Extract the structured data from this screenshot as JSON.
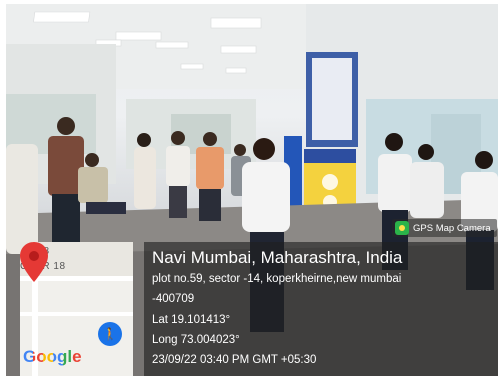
{
  "badge": {
    "label": "GPS Map Camera",
    "icon": "gps-camera-icon"
  },
  "map": {
    "road_label_number": "18",
    "road_label_text": "CTOR 18",
    "brand": "Google",
    "pin_icon": "location-pin-icon",
    "walk_icon": "pedestrian-icon"
  },
  "location": {
    "title": "Navi Mumbai, Maharashtra, India",
    "address_line1": "plot no.59, sector -14, koperkheirne,new mumbai",
    "address_line2": "-400709",
    "lat": "Lat 19.101413°",
    "long": "Long 73.004023°",
    "datetime": "23/09/22 03:40 PM GMT +05:30"
  }
}
